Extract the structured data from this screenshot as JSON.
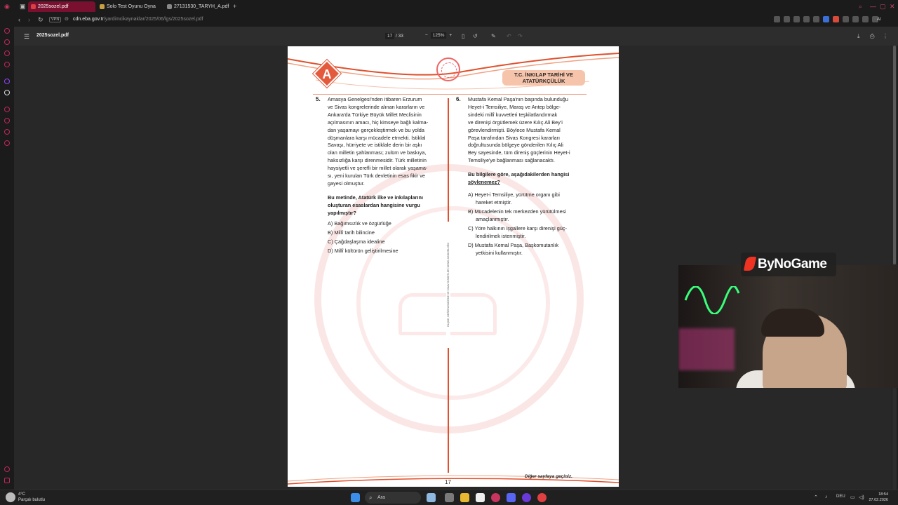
{
  "browser": {
    "tabs": [
      {
        "label": "2025sozel.pdf",
        "active": true
      },
      {
        "label": "Solo Test Oyunu Oyna",
        "active": false
      },
      {
        "label": "27131530_TARYH_A.pdf",
        "active": false
      }
    ],
    "new_tab_glyph": "+",
    "url_host": "cdn.eba.gov.tr",
    "url_path": "/yardimcikaynaklar/2025/06/lgs/2025sozel.pdf",
    "vpn_label": "VPN",
    "ai_label": "AI"
  },
  "pdf_toolbar": {
    "filename": "2025sozel.pdf",
    "current_page": "17",
    "page_separator": "/ 33",
    "zoom": "125%",
    "zoom_out": "−",
    "zoom_in": "+"
  },
  "page": {
    "booklet_letter": "A",
    "subject_line1": "T.C. İNKILAP TARİHİ VE",
    "subject_line2": "ATATÜRKÇÜLÜK",
    "page_number": "17",
    "next_page": "Diğer sayfaya geçiniz.",
    "side_caption": "ÖLÇME, DEĞERLENDİRME VE SINAV HİZMETLERİ GENEL MÜDÜRLÜĞÜ",
    "q5": {
      "number": "5.",
      "lines": [
        "Amasya Genelgesi'nden itibaren Erzurum",
        "ve Sivas kongrelerinde alınan kararların ve",
        "Ankara'da Türkiye Büyük Millet Meclisinin",
        "açılmasının amacı, hiç kimseye bağlı kalma-",
        "dan yaşamayı gerçekleştirmek ve bu yolda",
        "düşmanlara karşı mücadele etmekti. İstiklal",
        "Savaşı, hürriyete ve istiklale derin bir aşkı",
        "olan milletin şahlanması; zulüm ve baskıya,",
        "haksızlığa karşı direnmesidir. Türk milletinin",
        "haysiyetli ve şerefli bir millet olarak yaşama-",
        "sı, yeni kurulan Türk devletinin esas fikir ve",
        "gayesi olmuştur."
      ],
      "ask_line1": "Bu metinde, Atatürk ilke ve inkılaplarını",
      "ask_line2": "oluşturan esaslardan hangisine vurgu",
      "ask_line3": "yapılmıştır?",
      "options": [
        "A) Bağımsızlık ve özgürlüğe",
        "B) Millî tarih bilincine",
        "C) Çağdaşlaşma idealine",
        "D) Millî kültürün geliştirilmesine"
      ]
    },
    "q6": {
      "number": "6.",
      "lines": [
        "Mustafa Kemal Paşa'nın başında bulunduğu",
        "Heyet-i Temsiliye, Maraş ve Antep bölge-",
        "sindeki millî kuvvetleri teşkilatlandırmak",
        "ve direnişi örgütlemek üzere Kılıç Ali Bey'i",
        "görevlendirmişti. Böylece Mustafa Kemal",
        "Paşa tarafından Sivas Kongresi kararları",
        "doğrultusunda bölgeye gönderilen Kılıç Ali",
        "Bey sayesinde, tüm direniş güçlerinin Heyet-i",
        "Temsiliye'ye bağlanması sağlanacaktı."
      ],
      "ask_line1": "Bu bilgilere göre, aşağıdakilerden hangisi",
      "ask_line2": "söylenemez?",
      "options": [
        [
          "A) Heyet-i Temsiliye, yürütme organı gibi",
          "hareket etmiştir."
        ],
        [
          "B) Mücadelenin tek merkezden yürütülmesi",
          "amaçlanmıştır."
        ],
        [
          "C) Yöre halkının işgallere karşı direnişi güç-",
          "lendirilmek istenmiştir."
        ],
        [
          "D) Mustafa Kemal Paşa, Başkomutanlık",
          "yetkisini kullanmıştır."
        ]
      ]
    }
  },
  "overlay": {
    "logo_text": "ByNoGame"
  },
  "taskbar": {
    "temperature": "4°C",
    "weather_desc": "Parçalı bulutlu",
    "search_label": "Ara",
    "language": "DEU",
    "time": "18:54",
    "date": "27.02.2026"
  }
}
